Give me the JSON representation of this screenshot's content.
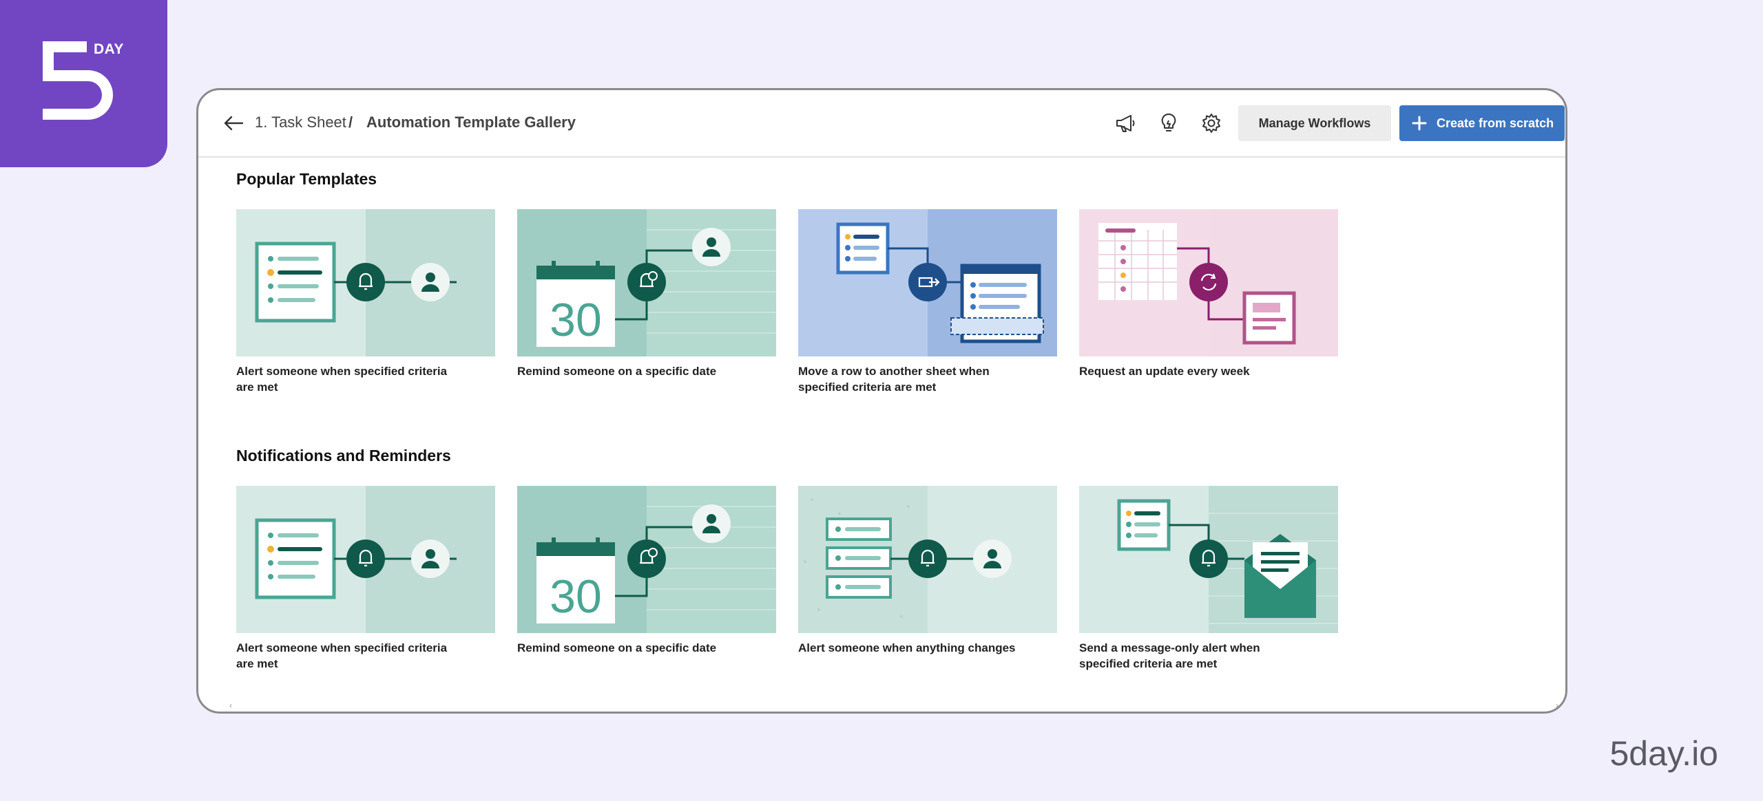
{
  "brand": {
    "badge_word": "DAY",
    "footer_domain": "5day.io"
  },
  "header": {
    "breadcrumb_parent": "1. Task Sheet",
    "breadcrumb_separator": "/",
    "breadcrumb_current": "Automation Template Gallery",
    "icons": [
      "megaphone-icon",
      "lightbulb-icon",
      "gear-icon"
    ],
    "manage_label": "Manage Workflows",
    "create_label": "Create from scratch",
    "create_color": "#3b75c1"
  },
  "sections": [
    {
      "title": "Popular Templates",
      "cards": [
        {
          "label": "Alert someone when specified criteria are met",
          "illustration": "sheet-bell-user"
        },
        {
          "label": "Remind someone on a specific date",
          "illustration": "calendar-30-alarm-user",
          "calendar_day": "30"
        },
        {
          "label": "Move a row to another sheet when specified criteria are met",
          "illustration": "sheet-move-sheet"
        },
        {
          "label": "Request an update every week",
          "illustration": "grid-refresh-form"
        }
      ]
    },
    {
      "title": "Notifications and Reminders",
      "cards": [
        {
          "label": "Alert someone when specified criteria are met",
          "illustration": "sheet-bell-user"
        },
        {
          "label": "Remind someone on a specific date",
          "illustration": "calendar-30-alarm-user",
          "calendar_day": "30"
        },
        {
          "label": "Alert someone when anything changes",
          "illustration": "rows-bell-user"
        },
        {
          "label": "Send a message-only alert when specified criteria are met",
          "illustration": "sheet-bell-envelope"
        }
      ]
    }
  ],
  "colors": {
    "brand_purple": "#7246c2",
    "teal_dark": "#0f5a4a",
    "teal": "#4aa593",
    "blue_dark": "#1e4f8a",
    "magenta": "#8a1f6a"
  }
}
